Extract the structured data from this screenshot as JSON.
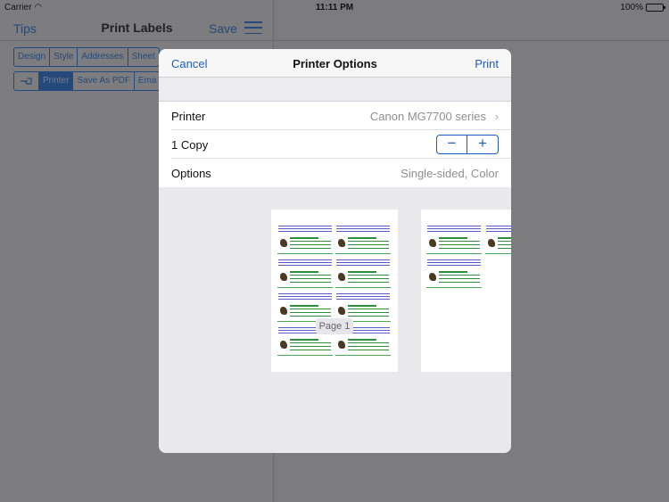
{
  "status": {
    "carrier": "Carrier",
    "time": "11:11 PM",
    "battery": "100%"
  },
  "navbar": {
    "tips": "Tips",
    "title": "Print Labels",
    "save": "Save"
  },
  "segments_row1": [
    "Design",
    "Style",
    "Addresses",
    "Sheet"
  ],
  "segments_row2": {
    "printer": "Printer",
    "save_pdf": "Save As PDF",
    "email_partial": "Ema"
  },
  "modal": {
    "cancel": "Cancel",
    "title": "Printer Options",
    "print": "Print",
    "rows": {
      "printer_label": "Printer",
      "printer_value": "Canon MG7700 series",
      "copies_label": "1 Copy",
      "options_label": "Options",
      "options_value": "Single-sided, Color"
    },
    "stepper": {
      "minus": "−",
      "plus": "+"
    },
    "page_label": "Page 1"
  }
}
